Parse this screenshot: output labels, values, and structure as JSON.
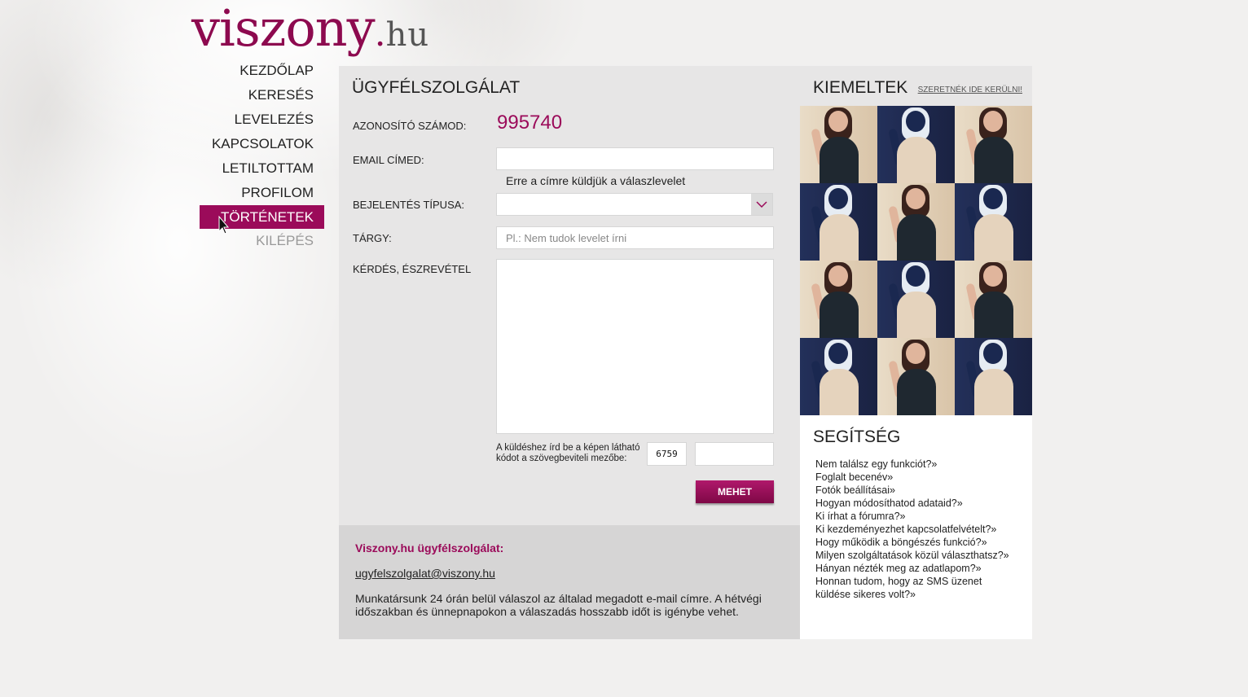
{
  "logo": {
    "main": "viszony",
    "dot": ".",
    "tld": "hu"
  },
  "nav": {
    "items": [
      {
        "label": "KEZDŐLAP"
      },
      {
        "label": "KERESÉS"
      },
      {
        "label": "LEVELEZÉS"
      },
      {
        "label": "KAPCSOLATOK"
      },
      {
        "label": "LETILTOTTAM"
      },
      {
        "label": "PROFILOM"
      },
      {
        "label": "TÖRTÉNETEK",
        "active": true
      },
      {
        "label": "KILÉPÉS",
        "muted": true
      }
    ]
  },
  "form": {
    "title": "ÜGYFÉLSZOLGÁLAT",
    "id_label": "AZONOSÍTÓ SZÁMOD:",
    "id_value": "995740",
    "email_label": "EMAIL CÍMED:",
    "email_value": "",
    "email_hint": "Erre a címre küldjük a válaszlevelet",
    "type_label": "BEJELENTÉS TÍPUSA:",
    "type_value": "",
    "subject_label": "TÁRGY:",
    "subject_placeholder": "Pl.: Nem tudok levelet írni",
    "question_label": "KÉRDÉS, ÉSZREVÉTEL",
    "captcha_text": "A küldéshez írd be a képen látható kódot a szövegbeviteli mezőbe:",
    "captcha_code": "6759",
    "submit_label": "MEHET"
  },
  "info": {
    "title": "Viszony.hu ügyfélszolgálat:",
    "email": "ugyfelszolgalat@viszony.hu",
    "text": "Munkatársunk 24 órán belül válaszol az általad megadott e-mail címre. A hétvégi időszakban és ünnepnapokon a válaszadás hosszabb időt is igénybe vehet."
  },
  "sidebar": {
    "featured_title": "KIEMELTEK",
    "featured_link": "SZERETNÉK IDE KERÜLNI!",
    "photos": [
      "a",
      "b",
      "a",
      "b",
      "a",
      "b",
      "a",
      "b",
      "a",
      "b",
      "a",
      "b"
    ],
    "help_title": "SEGÍTSÉG",
    "help_items": [
      "Nem találsz egy funkciót?»",
      "Foglalt becenév»",
      "Fotók beállításai»",
      "Hogyan módosíthatod adataid?»",
      "Ki írhat a fórumra?»",
      "Ki kezdeményezhet kapcsolatfelvételt?»",
      "Hogy működik a böngészés funkció?»",
      "Milyen szolgáltatások közül választhatsz?»",
      "Hányan nézték meg az adatlapom?»",
      "Honnan tudom, hogy az SMS üzenet küldése sikeres volt?»"
    ]
  },
  "colors": {
    "brand": "#9b0b5a",
    "panel": "#e7e6e6",
    "info_panel": "#d6d5d5"
  }
}
